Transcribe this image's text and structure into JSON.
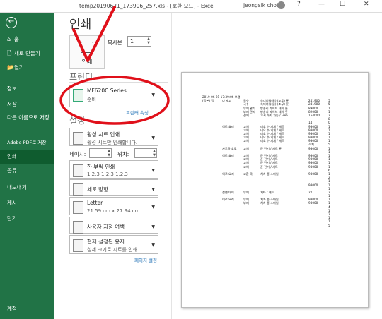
{
  "window": {
    "title": "temp20190621_173906_257.xls - [호환 모드] - Excel",
    "user": "jeongsik choi",
    "help": "?",
    "minimize": "—",
    "maximize": "☐",
    "close": "✕"
  },
  "sidebar": {
    "back": "←",
    "items": [
      {
        "label": "홈",
        "icon": "⌂"
      },
      {
        "label": "새로 만들기",
        "icon": "🗋"
      },
      {
        "label": "열기",
        "icon": "📂"
      },
      {
        "label": "정보",
        "icon": ""
      },
      {
        "label": "저장",
        "icon": ""
      },
      {
        "label": "다른 이름으로 저장",
        "icon": ""
      },
      {
        "label": "Adobe PDF로 저장",
        "icon": ""
      },
      {
        "label": "인쇄",
        "icon": ""
      },
      {
        "label": "공유",
        "icon": ""
      },
      {
        "label": "내보내기",
        "icon": ""
      },
      {
        "label": "게시",
        "icon": ""
      },
      {
        "label": "닫기",
        "icon": ""
      },
      {
        "label": "계정",
        "icon": ""
      }
    ]
  },
  "print": {
    "heading": "인쇄",
    "print_button": "인쇄",
    "copies_label": "복사본:",
    "copies_value": "1",
    "printer_section": "프린터",
    "printer_name": "MF620C Series",
    "printer_status": "준비",
    "printer_props_link": "프린터 속성",
    "settings_section": "설정",
    "settings": [
      {
        "line1": "활성 시트 인쇄",
        "line2": "활성 시트만 인쇄합니다."
      },
      {
        "line1": "한 부씩 인쇄",
        "line2": "1,2,3    1,2,3    1,2,3"
      },
      {
        "line1": "세로 방향",
        "line2": ""
      },
      {
        "line1": "Letter",
        "line2": "21.59 cm x 27.94 cm"
      },
      {
        "line1": "사용자 지정 여백",
        "line2": ""
      },
      {
        "line1": "현재 설정된 용지",
        "line2": "실제 크기로 시트를 인쇄..."
      }
    ],
    "pages_label": "페이지:",
    "to_label": "위치:",
    "page_setup_link": "페이지 설정"
  },
  "preview_sheet": {
    "header": "2019-06-21 17:39:06 부평",
    "rows": [
      [
        "(등본) 합",
        "다 재고",
        "국수",
        "숙디너워(물) (조무) 롯",
        "241900",
        "5"
      ],
      [
        "",
        "",
        "국수",
        "숙디너워(물) (조무) 롯",
        "241900",
        "5"
      ],
      [
        "",
        "",
        "부재 관리",
        "방송리 라이브 데이 롯",
        "89000",
        "1"
      ],
      [
        "",
        "",
        "부재 관리",
        "방송리 라이브 데이 롯",
        "89000",
        "1"
      ],
      [
        "",
        "",
        "전체",
        "고시 하기 가능 / Free",
        "154000",
        "2"
      ],
      [
        "",
        "",
        "",
        "",
        "",
        "8"
      ],
      [
        "",
        "",
        "",
        "",
        "14",
        "0"
      ],
      [
        "",
        "이르 요리",
        "교체",
        "네오 수 기계 / 세트",
        "98000",
        "1"
      ],
      [
        "",
        "",
        "교체",
        "네오 수 기계 / 세트",
        "98000",
        "1"
      ],
      [
        "",
        "",
        "교체",
        "네오 수 기계 / 세트",
        "98000",
        "1"
      ],
      [
        "",
        "",
        "교체",
        "네오 수 기계 / 세트",
        "98000",
        "1"
      ],
      [
        "",
        "",
        "교체",
        "네오 수 기계 / 세트",
        "98000",
        "1"
      ],
      [
        "",
        "",
        "",
        "",
        "소계",
        "5"
      ],
      [
        "",
        "사무용 오도",
        "교체",
        "준 전기 / 세트 롯",
        "98000",
        "1"
      ],
      [
        "",
        "",
        "",
        "",
        "",
        "1"
      ],
      [
        "",
        "이르 요리",
        "교체",
        "준 전기 / 세트",
        "98000",
        "1"
      ],
      [
        "",
        "",
        "교체",
        "준 전기 / 세트",
        "98000",
        "1"
      ],
      [
        "",
        "",
        "교체",
        "준 전기 / 세트",
        "98000",
        "1"
      ],
      [
        "",
        "",
        "교체",
        "준 전기 / 세트",
        "98000",
        "1"
      ],
      [
        "",
        "",
        "",
        "",
        "",
        "6"
      ],
      [
        "",
        "이르 요리",
        "교환 묵",
        "치차 종 스마일",
        "98000",
        "1"
      ],
      [
        "",
        "",
        "",
        "",
        "",
        "2"
      ],
      [
        "",
        "",
        "",
        "",
        "",
        "1"
      ],
      [
        "",
        "",
        "",
        "",
        "98000",
        "1"
      ],
      [
        "",
        "",
        "",
        "",
        "",
        "1"
      ],
      [
        "",
        "실캔 데이",
        "부재",
        "기타 / 세트",
        "22",
        "2"
      ],
      [
        "",
        "",
        "",
        "",
        "",
        "1"
      ],
      [
        "",
        "이르 요리",
        "부재",
        "치차 종 스마일",
        "98000",
        "1"
      ],
      [
        "",
        "",
        "부재",
        "치차 종 스마일",
        "98000",
        "1"
      ],
      [
        "",
        "",
        "",
        "",
        "",
        "4"
      ],
      [
        "",
        "",
        "",
        "",
        "",
        "1"
      ],
      [
        "",
        "",
        "",
        "",
        "",
        "2"
      ],
      [
        "",
        "",
        "",
        "",
        "",
        "1"
      ],
      [
        "",
        "",
        "",
        "",
        "",
        "1"
      ],
      [
        "",
        "",
        "",
        "",
        "",
        "5"
      ]
    ]
  },
  "colors": {
    "excel_green": "#217346",
    "active_green": "#0f5c2f",
    "annotation_red": "#e0101a",
    "link_blue": "#1e6fb5"
  }
}
